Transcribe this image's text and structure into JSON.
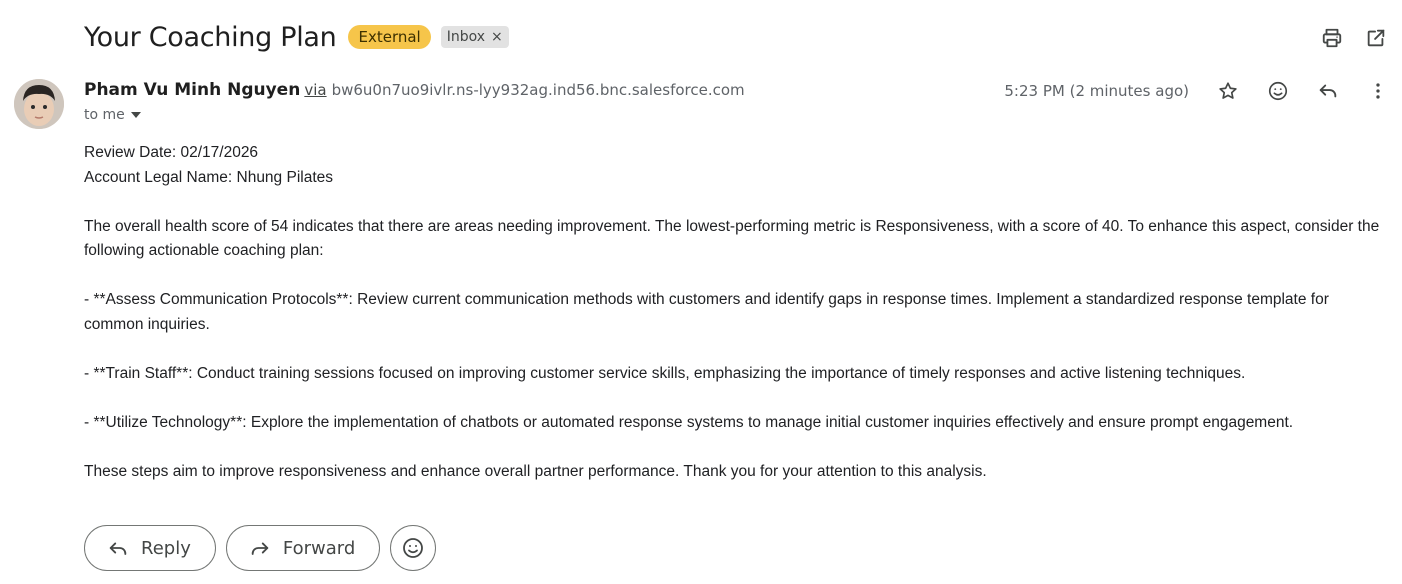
{
  "subject": "Your Coaching Plan",
  "labels": {
    "external": "External",
    "inbox": "Inbox",
    "inbox_remove": "×"
  },
  "sender": {
    "name": "Pham Vu Minh Nguyen",
    "via": "via",
    "via_address": "bw6u0n7uo9ivlr.ns-lyy932ag.ind56.bnc.salesforce.com",
    "to": "to me",
    "time": "5:23 PM (2 minutes ago)"
  },
  "icons": {
    "print": "print-icon",
    "open_new_window": "open-in-new-window-icon",
    "star": "star-icon",
    "emoji": "emoji-icon",
    "reply": "reply-icon",
    "more": "more-vertical-icon",
    "forward": "forward-icon"
  },
  "body": {
    "review_date": "Review Date: 02/17/2026",
    "account_name": "Account Legal Name: Nhung Pilates",
    "intro": "The overall health score of 54 indicates that there are areas needing improvement. The lowest-performing metric is Responsiveness, with a score of 40. To enhance this aspect, consider the following actionable coaching plan:",
    "item1": "- **Assess Communication Protocols**: Review current communication methods with customers and identify gaps in response times. Implement a standardized response template for common inquiries.",
    "item2": "- **Train Staff**: Conduct training sessions focused on improving customer service skills, emphasizing the importance of timely responses and active listening techniques.",
    "item3": "- **Utilize Technology**: Explore the implementation of chatbots or automated response systems to manage initial customer inquiries effectively and ensure prompt engagement.",
    "closing": "These steps aim to improve responsiveness and enhance overall partner performance. Thank you for your attention to this analysis."
  },
  "actions": {
    "reply": "Reply",
    "forward": "Forward"
  },
  "colors": {
    "external_badge": "#f6c54a",
    "inbox_badge": "#e2e2e2",
    "text": "#202124",
    "muted": "#5f6368"
  }
}
